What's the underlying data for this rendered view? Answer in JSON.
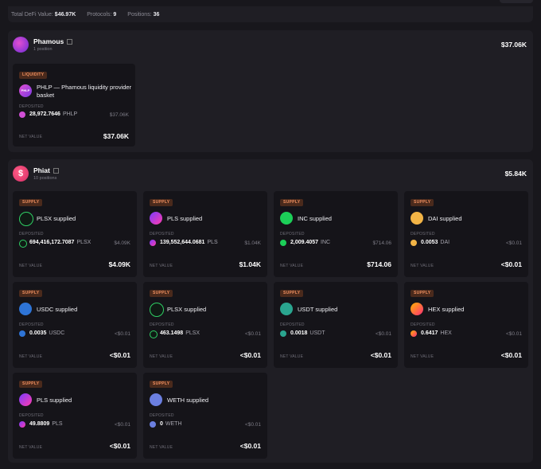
{
  "summary": {
    "defi_label": "Total DeFi Value:",
    "defi_value": "$46.97K",
    "protocols_label": "Protocols:",
    "protocols_value": "9",
    "positions_label": "Positions:",
    "positions_value": "36"
  },
  "labels": {
    "deposited": "DEPOSITED",
    "net_value": "NET VALUE"
  },
  "phamous": {
    "name": "Phamous",
    "positions": "1 position",
    "total": "$37.06K",
    "card": {
      "badge": "LIQUIDITY",
      "title": "PHLP — Phamous liquidity provider basket",
      "amount": "28,972.7646",
      "token": "PHLP",
      "usd": "$37.06K",
      "net": "$37.06K",
      "icon_text": "PHLP"
    }
  },
  "phiat": {
    "name": "Phiat",
    "positions": "10 positions",
    "total": "$5.84K",
    "cards": [
      {
        "badge": "SUPPLY",
        "title": "PLSX supplied",
        "amount": "694,416,172.7087",
        "token": "PLSX",
        "usd": "$4.09K",
        "net": "$4.09K",
        "icon": "plsx-icon"
      },
      {
        "badge": "SUPPLY",
        "title": "PLS supplied",
        "amount": "139,552,644.0681",
        "token": "PLS",
        "usd": "$1.04K",
        "net": "$1.04K",
        "icon": "pls-icon"
      },
      {
        "badge": "SUPPLY",
        "title": "INC supplied",
        "amount": "2,009.4057",
        "token": "INC",
        "usd": "$714.06",
        "net": "$714.06",
        "icon": "inc-icon"
      },
      {
        "badge": "SUPPLY",
        "title": "DAI supplied",
        "amount": "0.0053",
        "token": "DAI",
        "usd": "<$0.01",
        "net": "<$0.01",
        "icon": "dai-icon"
      },
      {
        "badge": "SUPPLY",
        "title": "USDC supplied",
        "amount": "0.0035",
        "token": "USDC",
        "usd": "<$0.01",
        "net": "<$0.01",
        "icon": "usdc-icon"
      },
      {
        "badge": "SUPPLY",
        "title": "PLSX supplied",
        "amount": "463.1498",
        "token": "PLSX",
        "usd": "<$0.01",
        "net": "<$0.01",
        "icon": "plsx-icon"
      },
      {
        "badge": "SUPPLY",
        "title": "USDT supplied",
        "amount": "0.0018",
        "token": "USDT",
        "usd": "<$0.01",
        "net": "<$0.01",
        "icon": "usdt-icon"
      },
      {
        "badge": "SUPPLY",
        "title": "HEX supplied",
        "amount": "0.6417",
        "token": "HEX",
        "usd": "<$0.01",
        "net": "<$0.01",
        "icon": "hex-icon"
      },
      {
        "badge": "SUPPLY",
        "title": "PLS supplied",
        "amount": "49.8809",
        "token": "PLS",
        "usd": "<$0.01",
        "net": "<$0.01",
        "icon": "pls-icon"
      },
      {
        "badge": "SUPPLY",
        "title": "WETH supplied",
        "amount": "0",
        "token": "WETH",
        "usd": "<$0.01",
        "net": "<$0.01",
        "icon": "weth-icon"
      }
    ]
  },
  "colors": {
    "accent": "#f39261",
    "card_bg": "#151419",
    "section_bg": "#1f1e24"
  }
}
